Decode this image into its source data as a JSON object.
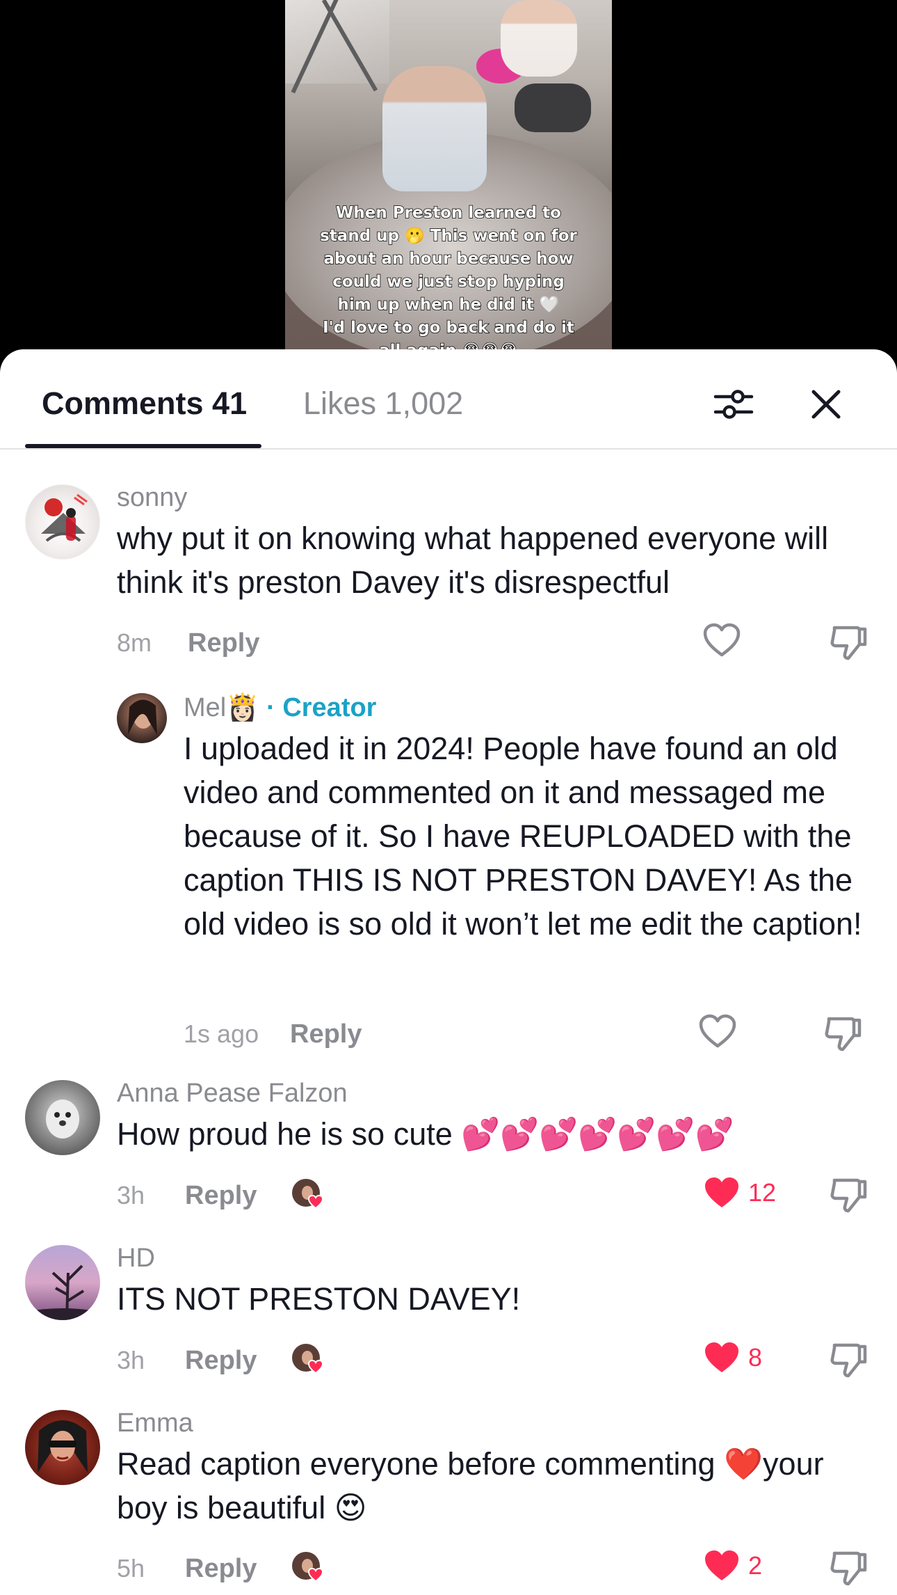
{
  "video": {
    "caption_lines": [
      "When Preston learned to",
      "stand up 🫢 This went on for",
      "about an hour because how",
      "could we just stop hyping",
      "him up when he did it 🤍",
      "I'd love to go back and do it",
      "all again 😭😭😭"
    ]
  },
  "tabs": {
    "comments_label": "Comments 41",
    "likes_label": "Likes 1,002"
  },
  "icons": {
    "filter": "sliders-icon",
    "close": "close-icon",
    "like": "heart-icon",
    "dislike": "thumbs-down-icon"
  },
  "colors": {
    "accent": "#fe2c55",
    "creator": "#1ba2c6",
    "muted": "#8a8b91"
  },
  "comments": [
    {
      "username": "sonny",
      "text": "why put it on knowing what happened everyone will think it's preston Davey it's disrespectful",
      "time": "8m",
      "reply_label": "Reply",
      "liked": false,
      "like_count": ""
    },
    {
      "username": "Mel👸🏻",
      "creator_label": "· Creator",
      "text": "I uploaded it in 2024! People have found an old video and commented on it and messaged me because of it. So I have REUPLOADED with the caption THIS IS NOT PRESTON DAVEY! As the old video is so old it won’t let me edit the caption!",
      "time": "1s ago",
      "reply_label": "Reply",
      "liked": false,
      "like_count": ""
    },
    {
      "username": "Anna Pease Falzon",
      "text": "How proud he is so cute 💕💕💕💕💕💕💕",
      "time": "3h",
      "reply_label": "Reply",
      "liked": true,
      "like_count": "12"
    },
    {
      "username": "HD",
      "text": "ITS NOT PRESTON DAVEY!",
      "time": "3h",
      "reply_label": "Reply",
      "liked": true,
      "like_count": "8"
    },
    {
      "username": "Emma",
      "text": "Read caption everyone before commenting ❤️your boy is beautiful 😍",
      "time": "5h",
      "reply_label": "Reply",
      "liked": true,
      "like_count": "2"
    }
  ]
}
